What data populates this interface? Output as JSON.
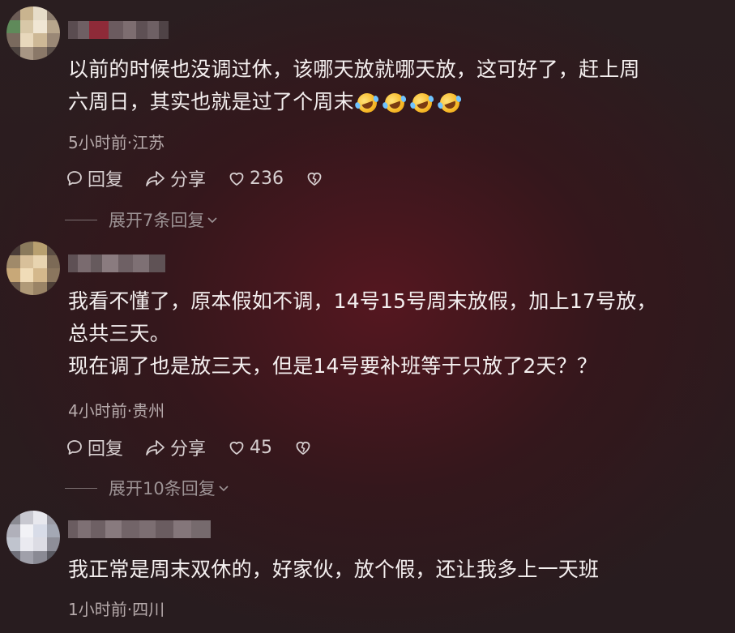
{
  "comments": [
    {
      "text_lines": [
        "以前的时候也没调过休，该哪天放就哪天放，这可好了，赶上周",
        "六周日，其实也就是过了个周末"
      ],
      "emojis": [
        "rolling-laughing-emoji",
        "rolling-laughing-emoji",
        "rolling-laughing-emoji",
        "rolling-laughing-emoji"
      ],
      "meta": "5小时前·江苏",
      "reply_label": "回复",
      "share_label": "分享",
      "like_count": "236",
      "expand_label": "展开7条回复"
    },
    {
      "text_lines": [
        "我看不懂了，原本假如不调，14号15号周末放假，加上17号放，",
        "总共三天。",
        "现在调了也是放三天，但是14号要补班等于只放了2天？？"
      ],
      "meta": "4小时前·贵州",
      "reply_label": "回复",
      "share_label": "分享",
      "like_count": "45",
      "expand_label": "展开10条回复"
    },
    {
      "text_lines": [
        "我正常是周末双休的，好家伙，放个假，还让我多上一天班"
      ],
      "meta": "1小时前·四川"
    }
  ],
  "colors": {
    "text": "#f4efef",
    "meta": "#b6aaab",
    "action": "#d7cfd0",
    "expand": "#9d9395"
  }
}
